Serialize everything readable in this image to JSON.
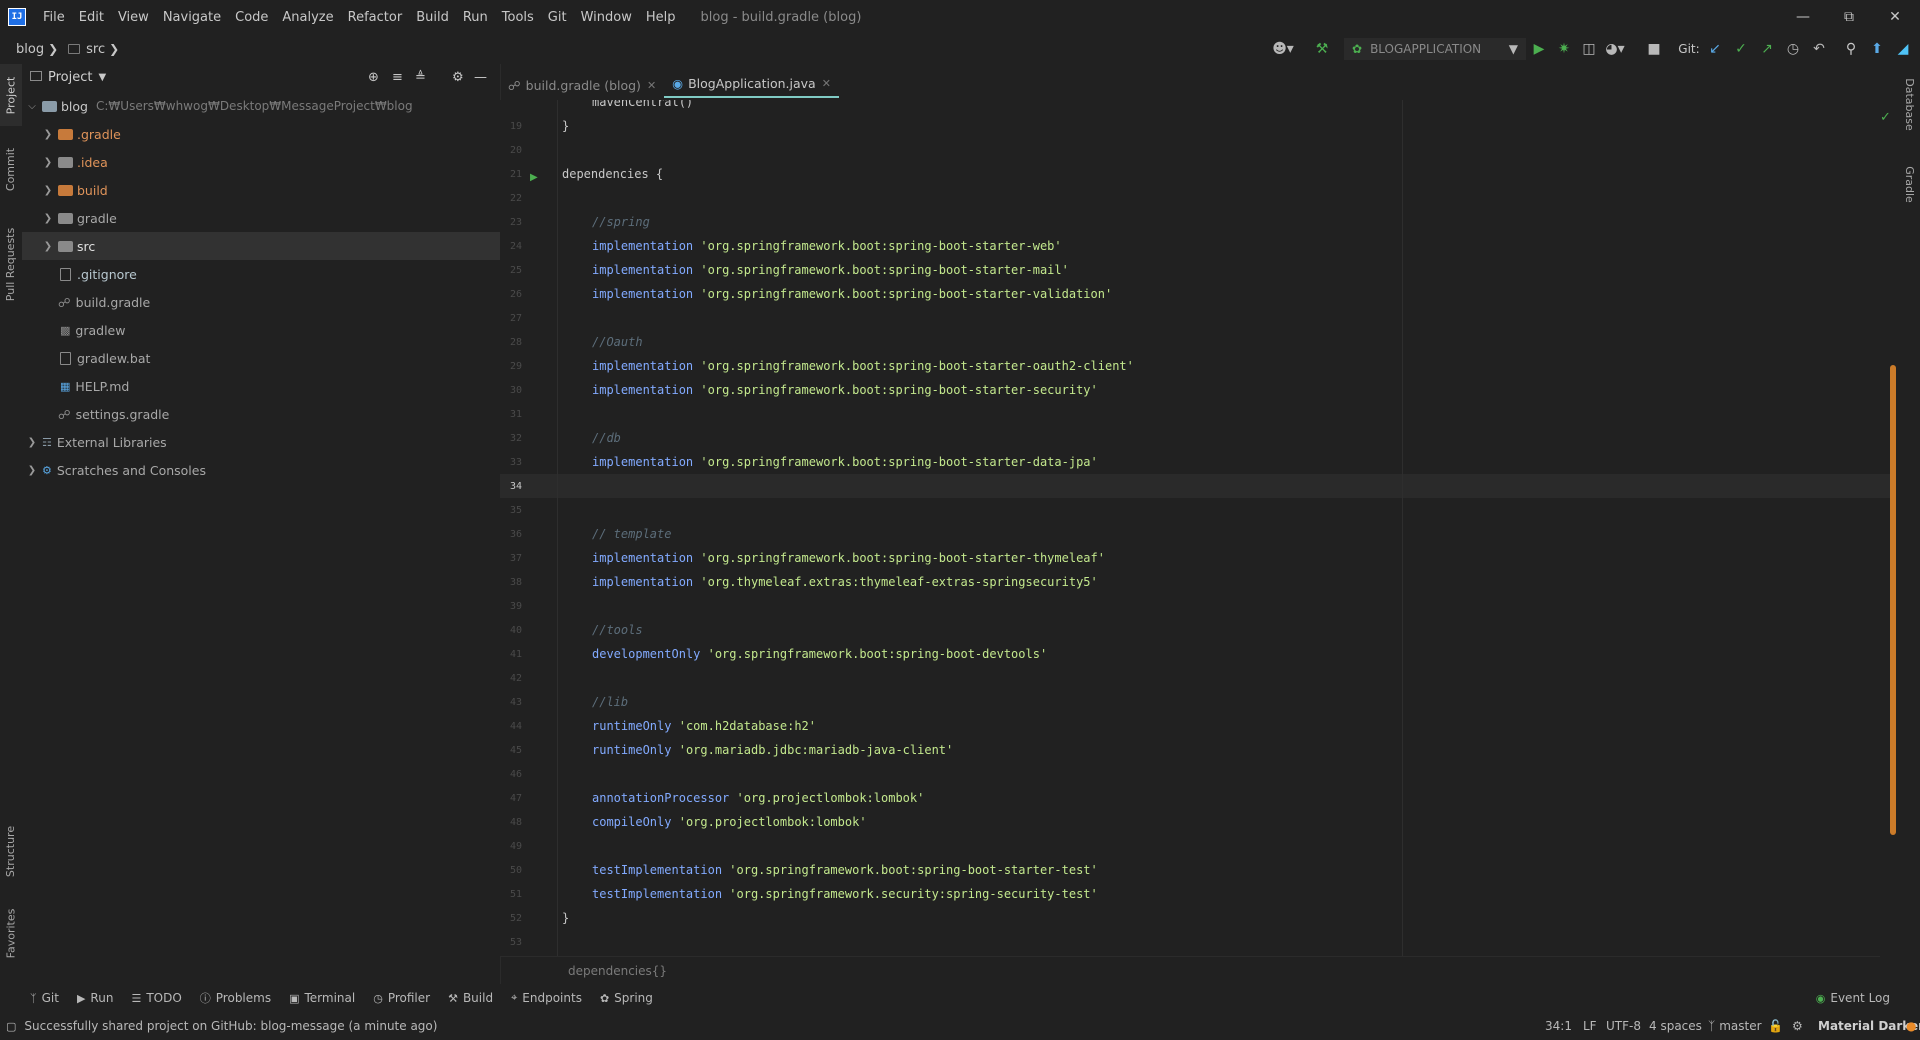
{
  "menu": {
    "items": [
      "File",
      "Edit",
      "View",
      "Navigate",
      "Code",
      "Analyze",
      "Refactor",
      "Build",
      "Run",
      "Tools",
      "Git",
      "Window",
      "Help"
    ],
    "window_title": "blog - build.gradle (blog)"
  },
  "navbar": {
    "crumbs": [
      "blog",
      "src"
    ]
  },
  "toolbar": {
    "run_config": "BLOGAPPLICATION",
    "git_label": "Git:"
  },
  "side_tabs": {
    "project": "Project",
    "commit": "Commit",
    "pull_requests": "Pull Requests",
    "structure": "Structure",
    "favorites": "Favorites",
    "database": "Database",
    "gradle": "Gradle"
  },
  "project": {
    "title": "Project",
    "root": {
      "name": "blog",
      "path": "C:₩Users₩whwog₩Desktop₩MessageProject₩blog"
    },
    "items": [
      {
        "label": ".gradle"
      },
      {
        "label": ".idea"
      },
      {
        "label": "build"
      },
      {
        "label": "gradle"
      },
      {
        "label": "src"
      },
      {
        "label": ".gitignore"
      },
      {
        "label": "build.gradle"
      },
      {
        "label": "gradlew"
      },
      {
        "label": "gradlew.bat"
      },
      {
        "label": "HELP.md"
      },
      {
        "label": "settings.gradle"
      },
      {
        "label": "External Libraries"
      },
      {
        "label": "Scratches and Consoles"
      }
    ]
  },
  "editor": {
    "tabs": [
      {
        "label": "build.gradle (blog)"
      },
      {
        "label": "BlogApplication.java"
      }
    ],
    "breadcrumb": "dependencies{}",
    "lines": [
      {
        "n": "19",
        "text": "}"
      },
      {
        "n": "20",
        "text": ""
      },
      {
        "n": "21",
        "text": "dependencies {"
      },
      {
        "n": "22",
        "text": ""
      },
      {
        "n": "23",
        "cmt": "//spring"
      },
      {
        "n": "24",
        "kw": "implementation",
        "str": "'org.springframework.boot:spring-boot-starter-web'"
      },
      {
        "n": "25",
        "kw": "implementation",
        "str": "'org.springframework.boot:spring-boot-starter-mail'"
      },
      {
        "n": "26",
        "kw": "implementation",
        "str": "'org.springframework.boot:spring-boot-starter-validation'"
      },
      {
        "n": "27",
        "text": ""
      },
      {
        "n": "28",
        "cmt": "//Oauth"
      },
      {
        "n": "29",
        "kw": "implementation",
        "str": "'org.springframework.boot:spring-boot-starter-oauth2-client'"
      },
      {
        "n": "30",
        "kw": "implementation",
        "str": "'org.springframework.boot:spring-boot-starter-security'"
      },
      {
        "n": "31",
        "text": ""
      },
      {
        "n": "32",
        "cmt": "//db"
      },
      {
        "n": "33",
        "kw": "implementation",
        "str": "'org.springframework.boot:spring-boot-starter-data-jpa'"
      },
      {
        "n": "34",
        "text": ""
      },
      {
        "n": "35",
        "text": ""
      },
      {
        "n": "36",
        "cmt": "// template"
      },
      {
        "n": "37",
        "kw": "implementation",
        "str": "'org.springframework.boot:spring-boot-starter-thymeleaf'"
      },
      {
        "n": "38",
        "kw": "implementation",
        "str": "'org.thymeleaf.extras:thymeleaf-extras-springsecurity5'"
      },
      {
        "n": "39",
        "text": ""
      },
      {
        "n": "40",
        "cmt": "//tools"
      },
      {
        "n": "41",
        "kw": "developmentOnly",
        "str": "'org.springframework.boot:spring-boot-devtools'"
      },
      {
        "n": "42",
        "text": ""
      },
      {
        "n": "43",
        "cmt": "//lib"
      },
      {
        "n": "44",
        "kw": "runtimeOnly",
        "str": "'com.h2database:h2'"
      },
      {
        "n": "45",
        "kw": "runtimeOnly",
        "str": "'org.mariadb.jdbc:mariadb-java-client'"
      },
      {
        "n": "46",
        "text": ""
      },
      {
        "n": "47",
        "kw": "annotationProcessor",
        "str": "'org.projectlombok:lombok'"
      },
      {
        "n": "48",
        "kw": "compileOnly",
        "str": "'org.projectlombok:lombok'"
      },
      {
        "n": "49",
        "text": ""
      },
      {
        "n": "50",
        "kw": "testImplementation",
        "str": "'org.springframework.boot:spring-boot-starter-test'"
      },
      {
        "n": "51",
        "kw": "testImplementation",
        "str": "'org.springframework.security:spring-security-test'"
      },
      {
        "n": "52",
        "text": "}"
      },
      {
        "n": "53",
        "text": ""
      }
    ],
    "current_line": "34",
    "top_partial": "mavenCentral()"
  },
  "tool_windows": [
    "Git",
    "Run",
    "TODO",
    "Problems",
    "Terminal",
    "Profiler",
    "Build",
    "Endpoints",
    "Spring"
  ],
  "event_log": "Event Log",
  "status": {
    "message": "Successfully shared project on GitHub: blog-message (a minute ago)",
    "position": "34:1",
    "line_sep": "LF",
    "encoding": "UTF-8",
    "indent": "4 spaces",
    "branch": "master",
    "theme": "Material Darker"
  },
  "colors": {
    "accent": "#80cbc4",
    "keyword": "#82aaff",
    "string": "#c3e88d",
    "comment": "#5c6d7a",
    "scroll": "#e98b2a"
  }
}
